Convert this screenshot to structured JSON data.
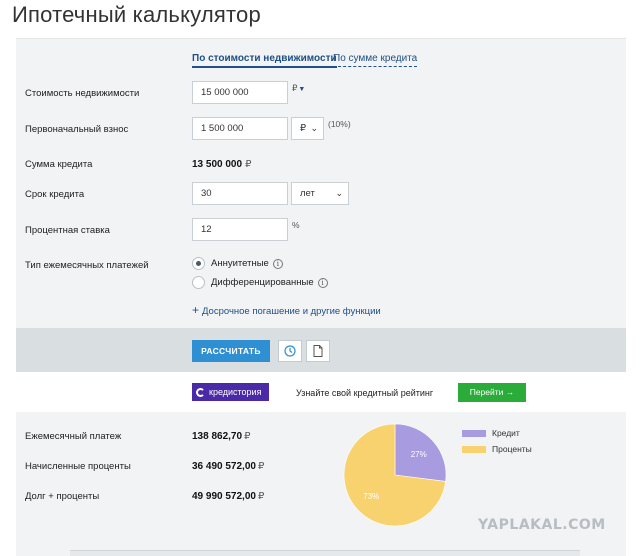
{
  "page": {
    "title": "Ипотечный калькулятор"
  },
  "tabs": {
    "by_price": "По стоимости недвижимости",
    "by_loan": "По сумме кредита"
  },
  "form": {
    "price_label": "Стоимость недвижимости",
    "price_value": "15 000 000",
    "price_currency": "₽",
    "down_label": "Первоначальный взнос",
    "down_value": "1 500 000",
    "down_unit": "₽",
    "down_percent": "(10%)",
    "loan_label": "Сумма кредита",
    "loan_value": "13 500 000",
    "loan_currency": "₽",
    "term_label": "Срок кредита",
    "term_value": "30",
    "term_unit": "лет",
    "rate_label": "Процентная ставка",
    "rate_value": "12",
    "rate_unit": "%",
    "payment_type_label": "Тип ежемесячных платежей",
    "annuity_label": "Аннуитетные",
    "diff_label": "Дифференцированные",
    "more_link": "Досрочное погашение и другие функции"
  },
  "actions": {
    "calculate": "РАССЧИТАТЬ"
  },
  "promo": {
    "logo_text": "кредистория",
    "text": "Узнайте свой кредитный рейтинг",
    "button": "Перейти →"
  },
  "results": {
    "monthly_label": "Ежемесячный платеж",
    "monthly_value": "138 862,70",
    "interest_label": "Начисленные проценты",
    "interest_value": "36 490 572,00",
    "total_label": "Долг + проценты",
    "total_value": "49 990 572,00",
    "currency": "₽"
  },
  "chart_data": {
    "type": "pie",
    "labels": [
      "Кредит",
      "Проценты"
    ],
    "values": [
      27,
      73
    ],
    "value_labels": [
      "27%",
      "73%"
    ],
    "colors": [
      "#a89be0",
      "#f8d26f"
    ],
    "legend_position": "right"
  },
  "watermark": "YAPLAKAL.COM"
}
